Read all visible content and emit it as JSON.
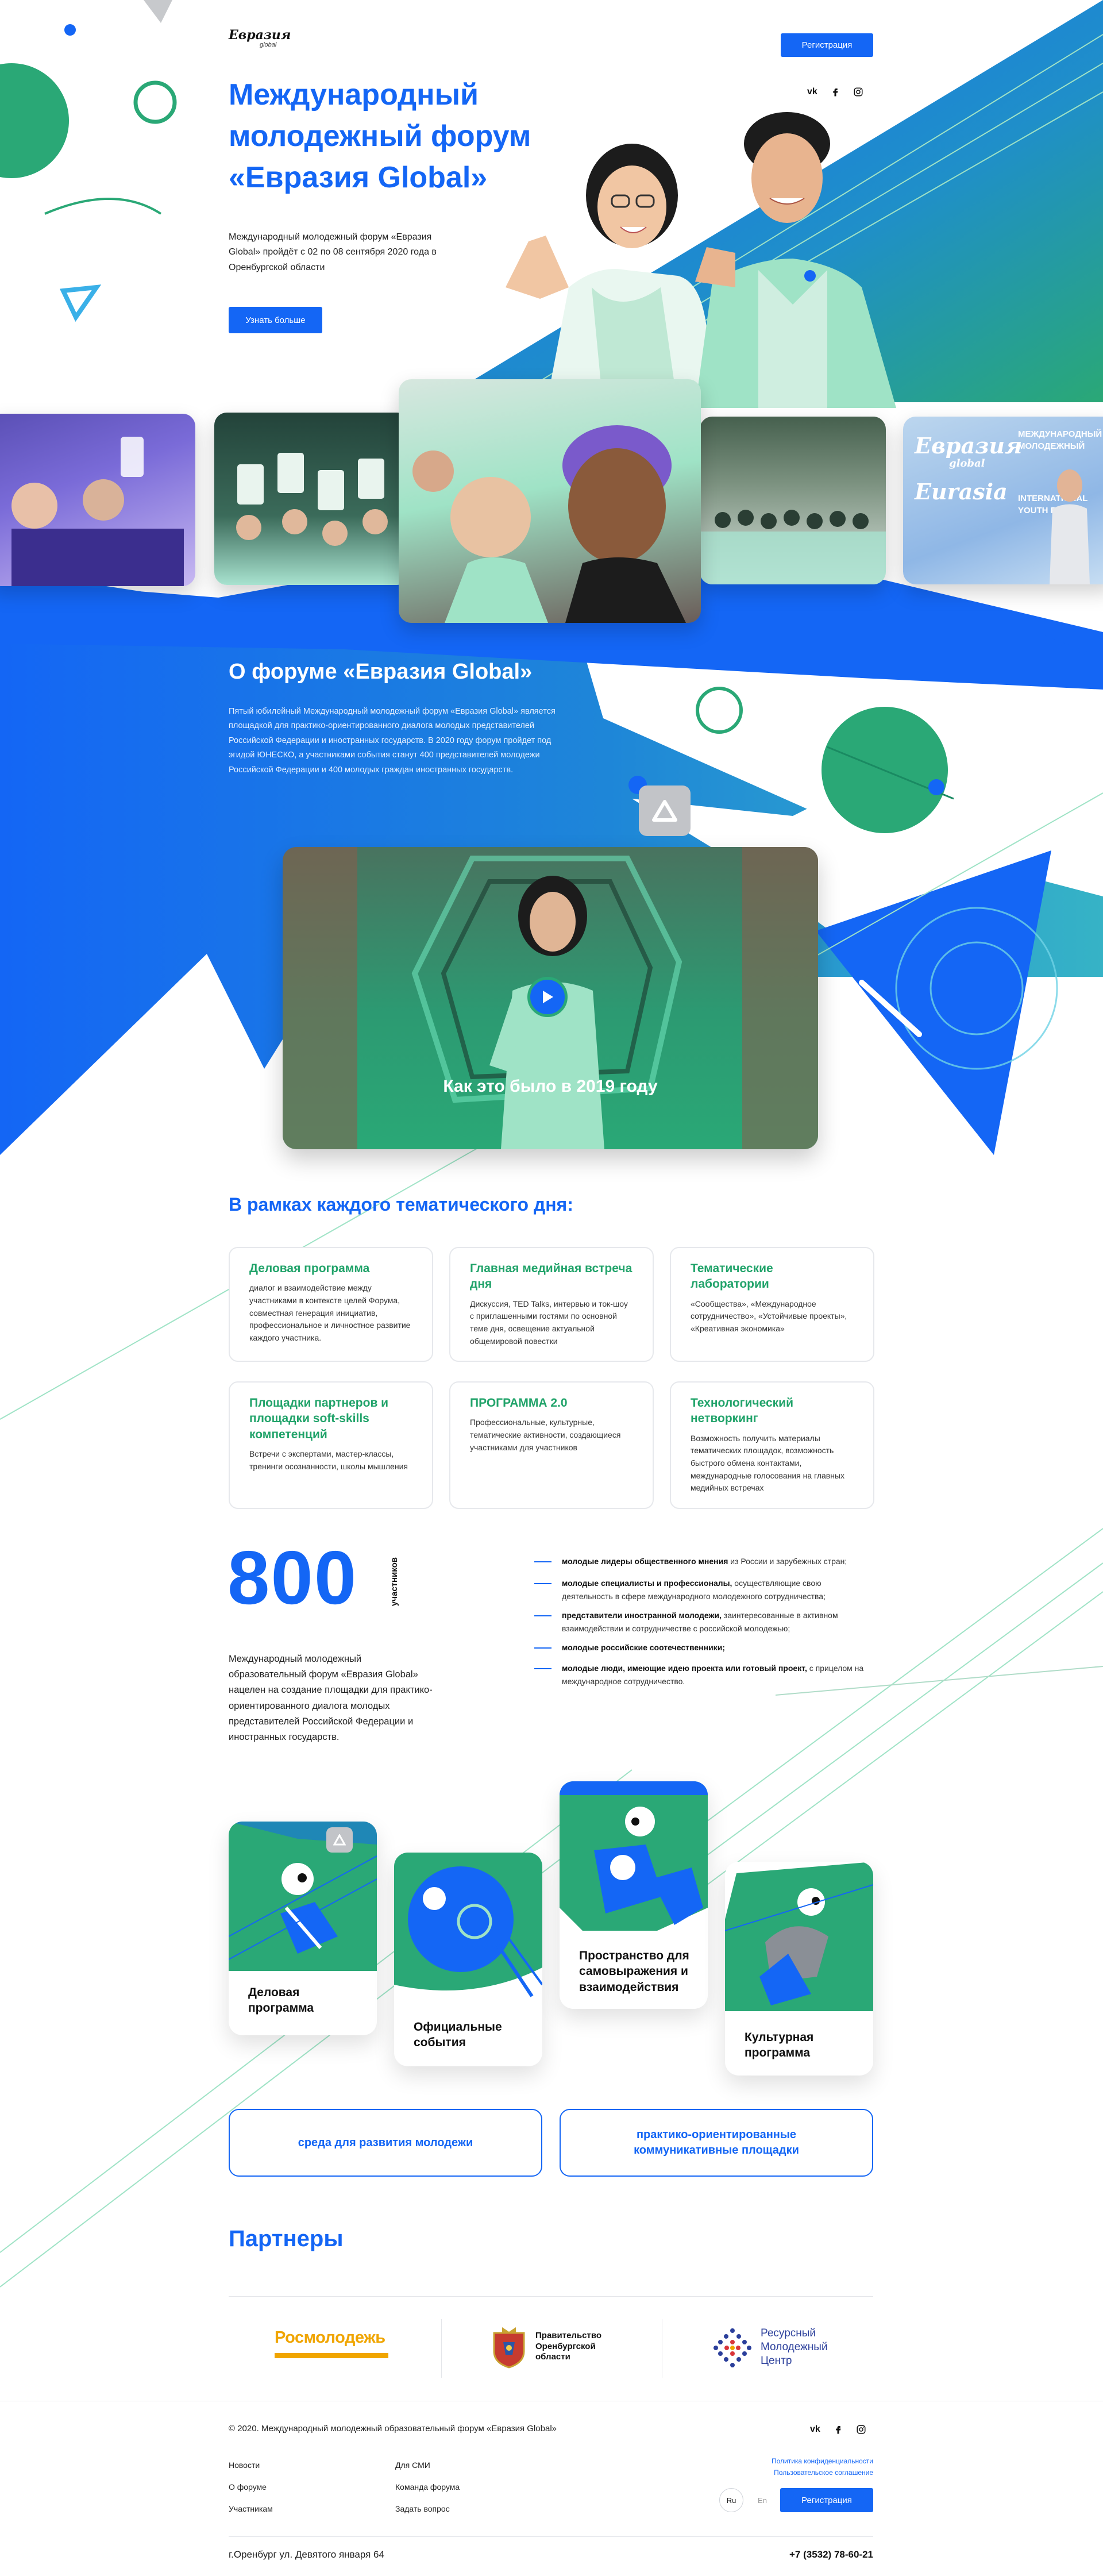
{
  "header": {
    "logo_text": "Евразия",
    "logo_sub": "global",
    "register_label": "Регистрация",
    "social": [
      "vk-icon",
      "facebook-icon",
      "instagram-icon"
    ],
    "vk_label": "vk"
  },
  "hero": {
    "title_line1": "Международный",
    "title_line2": "молодежный форум",
    "title_line3": "«Евразия Global»",
    "text": "Международный молодежный форум «Евразия Global» пройдёт с 02 по 08 сентября 2020 года в Оренбургской области",
    "cta_label": "Узнать больше"
  },
  "banner_texts": [
    "Евразия",
    "global",
    "Eurasia",
    "МЕЖДУНАРОДНЫЙ",
    "МОЛОДЕЖНЫЙ",
    "INTERNATIONAL",
    "YOUTH FORUM"
  ],
  "about": {
    "title": "О форуме «Евразия Global»",
    "text": "Пятый юбилейный Международный молодежный форум «Евразия Global» является площадкой для практико-ориентированного диалога молодых представителей Российской Федерации и иностранных государств. В 2020 году форум пройдет под эгидой ЮНЕСКО, а участниками события станут 400 представителей молодежи Российской Федерации и 400 молодых граждан иностранных государств."
  },
  "video": {
    "caption": "Как это было в 2019 году"
  },
  "thematic": {
    "title": "В рамках каждого тематического дня:",
    "cards": [
      {
        "title": "Деловая программа",
        "text": "диалог и взаимодействие между участниками в контексте целей Форума, совместная генерация инициатив, профессиональное и личностное развитие каждого участника."
      },
      {
        "title": "Главная медийная встреча дня",
        "text": "Дискуссия, TED Talks, интервью и ток-шоу с приглашенными гостями по основной теме дня, освещение актуальной общемировой повестки"
      },
      {
        "title": "Тематические лаборатории",
        "text": "«Сообщества», «Международное сотрудничество», «Устойчивые проекты», «Креативная экономика»"
      },
      {
        "title": "Площадки партнеров и площадки soft-skills компетенций",
        "text": "Встречи с экспертами, мастер-классы, тренинги осознанности, школы мышления"
      },
      {
        "title": "ПРОГРАММА 2.0",
        "text": "Профессиональные, культурные, тематические активности, создающиеся участниками для участников"
      },
      {
        "title": "Технологический нетворкинг",
        "text": "Возможность получить материалы тематических площадок, возможность быстрого обмена контактами, международные голосования на главных медийных встречах"
      }
    ]
  },
  "stats": {
    "number": "800",
    "unit": "участников",
    "text": "Международный молодежный образовательный форум «Евразия Global» нацелен на создание площадки для практико-ориентированного диалога молодых представителей Российской Федерации и иностранных государств.",
    "audience": [
      {
        "bold": "молодые лидеры общественного мнения",
        "rest": " из России и зарубежных стран;"
      },
      {
        "bold": "молодые специалисты и профессионалы,",
        "rest": " осуществляющие свою деятельность в сфере международного молодежного сотрудничества;"
      },
      {
        "bold": "представители иностранной молодежи,",
        "rest": " заинтересованные в активном взаимодействии и сотрудничестве с российской молодежью;"
      },
      {
        "bold": "молодые российские соотечественники;",
        "rest": ""
      },
      {
        "bold": "молодые люди, имеющие идею проекта или готовый проект,",
        "rest": " с прицелом на международное сотрудничество."
      }
    ]
  },
  "program_cards": [
    {
      "label": "Деловая программа"
    },
    {
      "label": "Официальные события"
    },
    {
      "label": "Пространство для самовыражения и взаимодействия"
    },
    {
      "label": "Культурная программа"
    }
  ],
  "pills": [
    {
      "label": "среда для развития молодежи"
    },
    {
      "label": "практико-ориентированные коммуникативные площадки"
    }
  ],
  "partners": {
    "title": "Партнеры",
    "items": [
      {
        "name": "Росмолодежь"
      },
      {
        "name": "Правительство Оренбургской области"
      },
      {
        "name": "Ресурсный Молодежный Центр"
      }
    ]
  },
  "footer": {
    "copyright": "© 2020. Международный молодежный образовательный форум «Евразия Global»",
    "links_col1": [
      "Новости",
      "О форуме",
      "Участникам"
    ],
    "links_col2": [
      "Для СМИ",
      "Команда форума",
      "Задать вопрос"
    ],
    "privacy": "Политика конфиденциальности",
    "agreement": "Пользовательское соглашение",
    "lang_ru": "Ru",
    "lang_en": "En",
    "register_label": "Регистрация",
    "address": "г.Оренбург ул. Девятого января 64",
    "phone": "+7 (3532) 78-60-21"
  },
  "colors": {
    "blue": "#1466f5",
    "green": "#2aa876",
    "mint": "#9fe3c6"
  }
}
